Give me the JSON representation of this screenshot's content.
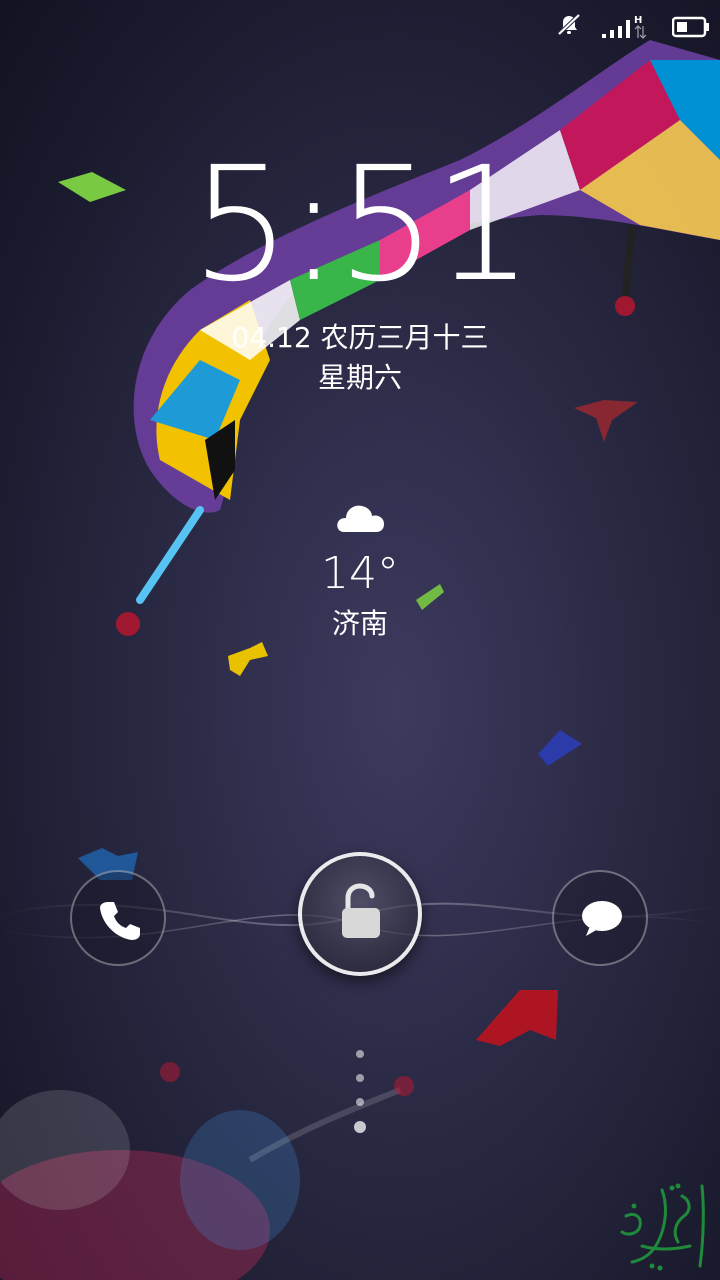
{
  "status_bar": {
    "icons": [
      "bell-muted-icon",
      "signal-icon",
      "battery-icon"
    ],
    "network_type": "H"
  },
  "lock_screen": {
    "time_hour": "5",
    "time_minute": "51",
    "date": "04.12 农历三月十三",
    "weekday": "星期六"
  },
  "weather": {
    "icon": "cloud-icon",
    "temperature": "14°",
    "city": "济南"
  },
  "shortcuts": {
    "left": "phone-icon",
    "center": "unlock-icon",
    "right": "message-icon"
  },
  "page_indicator": {
    "count": 4
  },
  "colors": {
    "background": "#2b2a45",
    "text": "#ffffff"
  }
}
